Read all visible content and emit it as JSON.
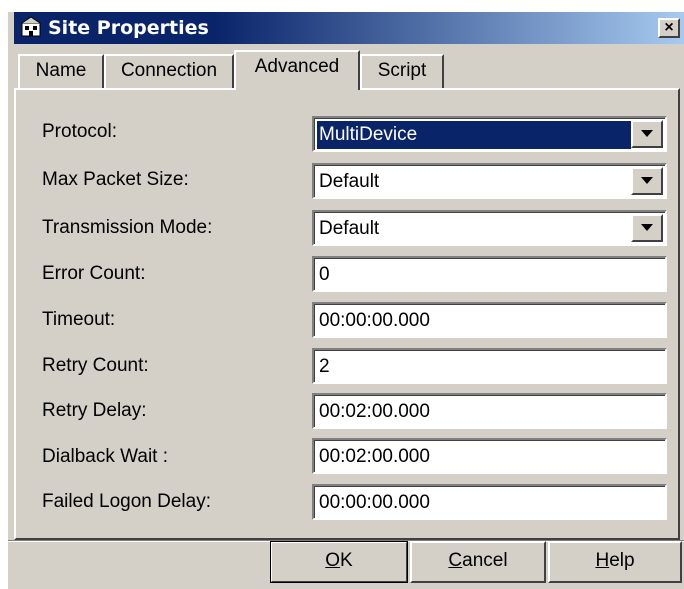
{
  "window": {
    "title": "Site Properties",
    "close_glyph": "×",
    "icon": "site-properties-icon"
  },
  "tabs": [
    {
      "label": "Name",
      "active": false
    },
    {
      "label": "Connection",
      "active": false
    },
    {
      "label": "Advanced",
      "active": true
    },
    {
      "label": "Script",
      "active": false
    }
  ],
  "form": {
    "fields": [
      {
        "label": "Protocol:",
        "value": "MultiDevice",
        "kind": "dropdown",
        "selected": true
      },
      {
        "label": "Max Packet Size:",
        "value": "Default",
        "kind": "dropdown"
      },
      {
        "label": "Transmission Mode:",
        "value": "Default",
        "kind": "dropdown"
      },
      {
        "label": "Error Count:",
        "value": "0",
        "kind": "text"
      },
      {
        "label": "Timeout:",
        "value": "00:00:00.000",
        "kind": "text"
      },
      {
        "label": "Retry Count:",
        "value": "2",
        "kind": "text"
      },
      {
        "label": "Retry Delay:",
        "value": "00:02:00.000",
        "kind": "text"
      },
      {
        "label": "Dialback Wait :",
        "value": "00:02:00.000",
        "kind": "text"
      },
      {
        "label": "Failed Logon Delay:",
        "value": "00:00:00.000",
        "kind": "text"
      }
    ]
  },
  "buttons": {
    "ok": {
      "mnemonic": "O",
      "rest": "K"
    },
    "cancel": {
      "mnemonic": "C",
      "rest": "ancel"
    },
    "help": {
      "mnemonic": "H",
      "rest": "elp"
    }
  },
  "colors": {
    "titlebar_start": "#0a246a",
    "titlebar_end": "#a6caf0",
    "face": "#d4d0c8",
    "selection": "#0a246a"
  }
}
